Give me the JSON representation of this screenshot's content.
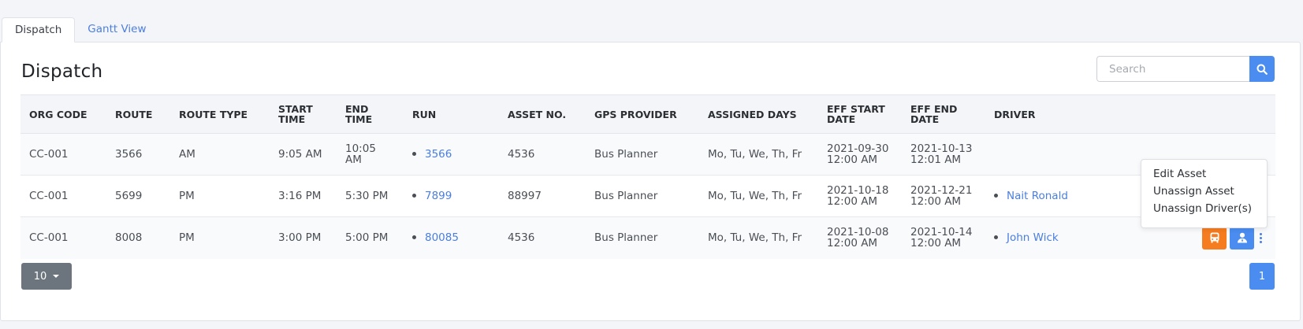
{
  "tabs": [
    {
      "label": "Dispatch",
      "active": true
    },
    {
      "label": "Gantt View",
      "active": false
    }
  ],
  "page_title": "Dispatch",
  "search": {
    "placeholder": "Search",
    "value": "",
    "icon": "search-icon"
  },
  "table": {
    "columns": [
      "ORG CODE",
      "ROUTE",
      "ROUTE TYPE",
      "START TIME",
      "END TIME",
      "RUN",
      "ASSET NO.",
      "GPS PROVIDER",
      "ASSIGNED DAYS",
      "EFF START DATE",
      "EFF END DATE",
      "DRIVER",
      ""
    ],
    "column_lines": {
      "start_time": [
        "START",
        "TIME"
      ],
      "eff_start": [
        "EFF START",
        "DATE"
      ],
      "eff_end": [
        "EFF END",
        "DATE"
      ]
    },
    "rows": [
      {
        "org_code": "CC-001",
        "route": "3566",
        "route_type": "AM",
        "start_time": "9:05 AM",
        "end_time": "10:05 AM",
        "run": "3566",
        "asset_no": "4536",
        "gps_provider": "Bus Planner",
        "assigned_days": "Mo, Tu, We, Th, Fr",
        "eff_start_date": "2021-09-30",
        "eff_start_time": "12:00 AM",
        "eff_end_date": "2021-10-13",
        "eff_end_time": "12:01 AM",
        "driver": ""
      },
      {
        "org_code": "CC-001",
        "route": "5699",
        "route_type": "PM",
        "start_time": "3:16 PM",
        "end_time": "5:30 PM",
        "run": "7899",
        "asset_no": "88997",
        "gps_provider": "Bus Planner",
        "assigned_days": "Mo, Tu, We, Th, Fr",
        "eff_start_date": "2021-10-18",
        "eff_start_time": "12:00 AM",
        "eff_end_date": "2021-12-21",
        "eff_end_time": "12:00 AM",
        "driver": "Nait Ronald"
      },
      {
        "org_code": "CC-001",
        "route": "8008",
        "route_type": "PM",
        "start_time": "3:00 PM",
        "end_time": "5:00 PM",
        "run": "80085",
        "asset_no": "4536",
        "gps_provider": "Bus Planner",
        "assigned_days": "Mo, Tu, We, Th, Fr",
        "eff_start_date": "2021-10-08",
        "eff_start_time": "12:00 AM",
        "eff_end_date": "2021-10-14",
        "eff_end_time": "12:00 AM",
        "driver": "John Wick"
      }
    ]
  },
  "context_menu": {
    "items": [
      "Edit Asset",
      "Unassign Asset",
      "Unassign Driver(s)"
    ]
  },
  "pagination": {
    "page_size": "10",
    "current_page": "1"
  },
  "icons": {
    "asset": "bus-icon",
    "driver": "person-icon",
    "more": "kebab-menu-icon"
  },
  "colors": {
    "primary": "#4a8cf0",
    "link": "#4a7ee0",
    "orange": "#f57c1f",
    "secondary": "#6c757d"
  }
}
